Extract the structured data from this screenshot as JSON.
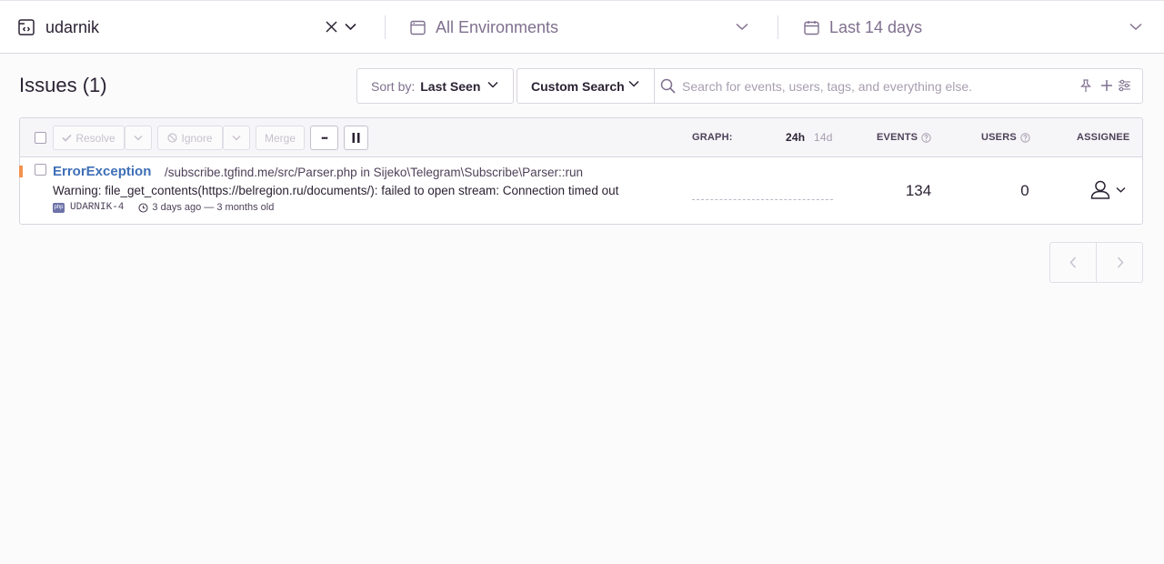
{
  "filters": {
    "project": {
      "name": "udarnik",
      "icon": "project-icon"
    },
    "environment": {
      "label": "All Environments",
      "icon": "environment-icon"
    },
    "date_range": {
      "label": "Last 14 days",
      "icon": "calendar-icon"
    }
  },
  "header": {
    "title": "Issues",
    "count": "(1)",
    "sort": {
      "prefix": "Sort by:",
      "value": "Last Seen"
    },
    "custom_search": "Custom Search",
    "search": {
      "placeholder": "Search for events, users, tags, and everything else.",
      "value": ""
    }
  },
  "toolbar": {
    "resolve": "Resolve",
    "ignore": "Ignore",
    "merge": "Merge",
    "more": "•••"
  },
  "columns": {
    "graph": "GRAPH:",
    "range_24h": "24h",
    "range_14d": "14d",
    "events": "EVENTS",
    "users": "USERS",
    "assignee": "ASSIGNEE"
  },
  "issues": [
    {
      "title": "ErrorException",
      "culprit": "/subscribe.tgfind.me/src/Parser.php in Sijeko\\Telegram\\Subscribe\\Parser::run",
      "message": "Warning: file_get_contents(https://belregion.ru/documents/): failed to open stream: Connection timed out",
      "platform": "php",
      "short_id": "UDARNIK-4",
      "time": "3 days ago — 3 months old",
      "events": "134",
      "users": "0",
      "level_color": "#f0924e"
    }
  ],
  "colors": {
    "accent_link": "#3e6fb7",
    "level_bar": "#f0924e",
    "text_primary": "#2b2233",
    "text_muted": "#80708f"
  }
}
